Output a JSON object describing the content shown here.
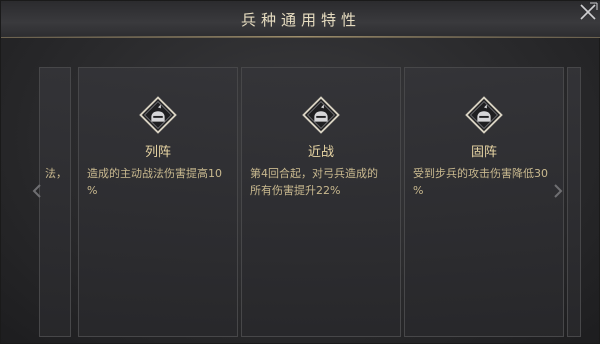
{
  "header": {
    "title": "兵种通用特性"
  },
  "left_partial": {
    "text": "法，"
  },
  "cards": [
    {
      "title": "列阵",
      "desc_line1": "造成的主动战法伤害提高10",
      "desc_line2": "%",
      "icon": "soldier-helmet-icon"
    },
    {
      "title": "近战",
      "desc_line1": "第4回合起，对弓兵造成的",
      "desc_line2": "所有伤害提升22%",
      "icon": "soldier-helmet-icon"
    },
    {
      "title": "固阵",
      "desc_line1": "受到步兵的攻击伤害降低30",
      "desc_line2": "%",
      "icon": "soldier-helmet-icon"
    }
  ],
  "colors": {
    "title": "#e6dcc0",
    "card_title": "#e9d6a4",
    "desc": "#c9b98f",
    "accent_line": "#c4b080"
  },
  "icons": {
    "close": "close-x-icon",
    "prev": "chevron-left-icon",
    "next": "chevron-right-icon"
  }
}
